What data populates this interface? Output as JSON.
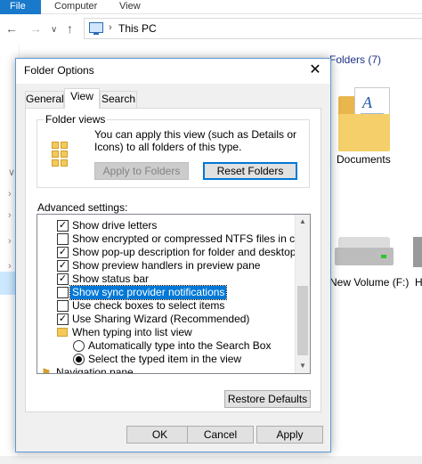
{
  "explorer": {
    "ribbon_tabs": [
      "File",
      "Computer",
      "View"
    ],
    "back_glyph": "←",
    "forward_glyph": "→",
    "dropdown_glyph": "∨",
    "up_glyph": "↑",
    "breadcrumb_sep": "›",
    "address": "This PC",
    "folders_header": "Folders (7)",
    "documents_label": "Documents",
    "drive_label": "New Volume (F:)",
    "drive_label_2": "H",
    "nav_chevrons": [
      "∨",
      "›",
      "›",
      "›",
      "›"
    ]
  },
  "dialog": {
    "title": "Folder Options",
    "close_glyph": "✕",
    "tabs": [
      "General",
      "View",
      "Search"
    ],
    "active_tab": "View",
    "folder_views": {
      "label": "Folder views",
      "description": "You can apply this view (such as Details or Icons) to all folders of this type.",
      "apply_button": "Apply to Folders",
      "reset_button": "Reset Folders"
    },
    "advanced_label": "Advanced settings:",
    "settings": [
      {
        "type": "checkbox",
        "checked": true,
        "label": "Show drive letters"
      },
      {
        "type": "checkbox",
        "checked": false,
        "label": "Show encrypted or compressed NTFS files in color"
      },
      {
        "type": "checkbox",
        "checked": true,
        "label": "Show pop-up description for folder and desktop items"
      },
      {
        "type": "checkbox",
        "checked": true,
        "label": "Show preview handlers in preview pane"
      },
      {
        "type": "checkbox",
        "checked": true,
        "label": "Show status bar"
      },
      {
        "type": "checkbox",
        "checked": false,
        "label": "Show sync provider notifications",
        "selected": true
      },
      {
        "type": "checkbox",
        "checked": false,
        "label": "Use check boxes to select items"
      },
      {
        "type": "checkbox",
        "checked": true,
        "label": "Use Sharing Wizard (Recommended)"
      },
      {
        "type": "folder",
        "label": "When typing into list view"
      },
      {
        "type": "radio",
        "checked": false,
        "label": "Automatically type into the Search Box"
      },
      {
        "type": "radio",
        "checked": true,
        "label": "Select the typed item in the view"
      },
      {
        "type": "folder",
        "label": "Navigation pane"
      }
    ],
    "check_glyph": "✓",
    "restore_button": "Restore Defaults",
    "ok_button": "OK",
    "cancel_button": "Cancel",
    "apply_button": "Apply"
  }
}
